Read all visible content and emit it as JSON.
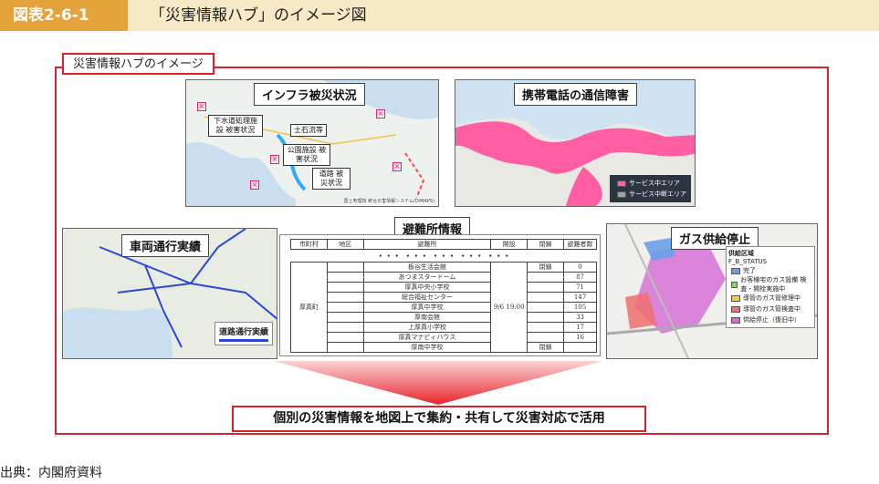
{
  "header": {
    "figure_number": "図表2-6-1",
    "title": "「災害情報ハブ」のイメージ図"
  },
  "frame_label": "災害情報ハブのイメージ",
  "panels": {
    "infra": {
      "title": "インフラ被災状況",
      "labels": {
        "sewage": "下水道処理施設 被害状況",
        "debris": "土石流等",
        "public": "公園施設 被害状況",
        "road": "道路 被災状況"
      },
      "credit": "国土地理院 統合災害情報システム(DiMAPS)"
    },
    "mobile": {
      "title": "携帯電話の通信障害",
      "legend": [
        "サービス中エリア",
        "サービス中断エリア"
      ],
      "colors": {
        "in_service": "#ff5fa2",
        "interrupted": "#9aa3ad"
      }
    },
    "vehicle": {
      "title": "車両通行実績",
      "legend_label": "道路通行実績"
    },
    "shelter": {
      "title": "避難所情報",
      "columns": [
        "市町村",
        "地区",
        "避難所",
        "開設",
        "閉鎖",
        "避難者数"
      ],
      "ellipsis": "・・・ ・・・ ・・・ ・・・ ・・・",
      "municipality": "厚真町",
      "opened": "9/6 19:00",
      "rows": [
        {
          "name": "板谷生活会館",
          "closed": "閉鎖",
          "count": "0"
        },
        {
          "name": "あつまスタードーム",
          "closed": "",
          "count": "87"
        },
        {
          "name": "厚真中央小学校",
          "closed": "",
          "count": "71"
        },
        {
          "name": "総合福祉センター",
          "closed": "",
          "count": "147"
        },
        {
          "name": "厚真中学校",
          "closed": "",
          "count": "105"
        },
        {
          "name": "厚南会館",
          "closed": "",
          "count": "33"
        },
        {
          "name": "上厚真小学校",
          "closed": "",
          "count": "17"
        },
        {
          "name": "厚真マナビィハウス",
          "closed": "",
          "count": "16"
        },
        {
          "name": "厚南中学校",
          "closed": "閉鎖",
          "count": ""
        }
      ]
    },
    "gas": {
      "title": "ガス供給停止",
      "legend_title": "供給区域",
      "legend_field": "F_B_STATUS",
      "legend_items": [
        {
          "label": "完了",
          "color": "#6aa0e8"
        },
        {
          "label": "お客様宅のガス設備 検査・開栓実施中",
          "color": "#8ad66a"
        },
        {
          "label": "導管のガス管修理中",
          "color": "#f0d040"
        },
        {
          "label": "導管のガス管検査中",
          "color": "#f07070"
        },
        {
          "label": "供給停止（復旧中）",
          "color": "#d66ad6"
        }
      ]
    }
  },
  "bottom_message": "個別の災害情報を地図上で集約・共有して災害対応で活用",
  "source": "出典：内閣府資料"
}
